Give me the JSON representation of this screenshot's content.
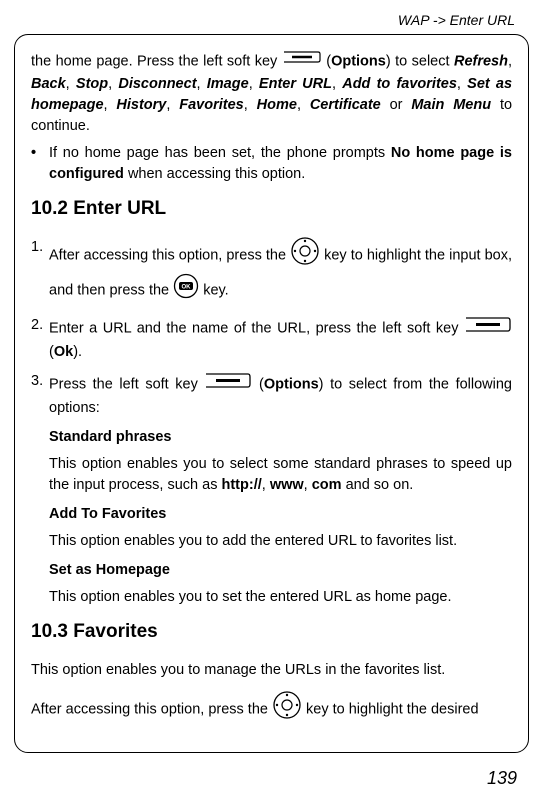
{
  "header": "WAP -> Enter URL",
  "page_number": "139",
  "intro": {
    "pre1": "the home page. Press the left soft key ",
    "post1_a": " (",
    "options": "Options",
    "post1_b": ") to select ",
    "list": "Refresh, Back, Stop, Disconnect, Image, Enter URL, Add to favorites, Set as homepage, History, Favorites, Home, Certificate",
    "r": "Refresh",
    "b": "Back",
    "s": "Stop",
    "d": "Disconnect",
    "im": "Image",
    "eu": "Enter URL",
    "af": "Add to favorites",
    "sh": "Set as homepage",
    "hi": "History",
    "fa": "Favorites",
    "ho": "Home",
    "ce": "Certificate",
    "or": " or ",
    "mm": "Main Menu",
    "tc": " to continue."
  },
  "bullet": {
    "pre": "If no home page has been set, the phone prompts ",
    "bold": "No home page is configured",
    "post": " when accessing this option."
  },
  "h_10_2": "10.2 Enter URL",
  "step1": {
    "a": "After accessing this option, press the ",
    "b": " key to highlight the input box, and then press the ",
    "c": " key."
  },
  "step2": {
    "a": "Enter a URL and the name of the URL, press the left soft key ",
    "b": " (",
    "ok": "Ok",
    "c": ")."
  },
  "step3": {
    "a": "Press the left soft key ",
    "b": " (",
    "options": "Options",
    "c": ") to select from the following options:"
  },
  "sp_head": "Standard phrases",
  "sp_text_a": "This option enables you to select some standard phrases to speed up the input process, such as ",
  "sp_http": "http://",
  "sp_comma1": ", ",
  "sp_www": "www",
  "sp_comma2": ", ",
  "sp_com": "com",
  "sp_text_b": " and so on.",
  "af_head": "Add To Favorites",
  "af_text": "This option enables you to add the entered URL to favorites list.",
  "sh_head": "Set as Homepage",
  "sh_text": "This option enables you to set the entered URL as home page.",
  "h_10_3": "10.3 Favorites",
  "fav_intro": "This option enables you to manage the URLs in the favorites list.",
  "fav_step_a": "After accessing this option, press the ",
  "fav_step_b": " key to highlight the desired"
}
